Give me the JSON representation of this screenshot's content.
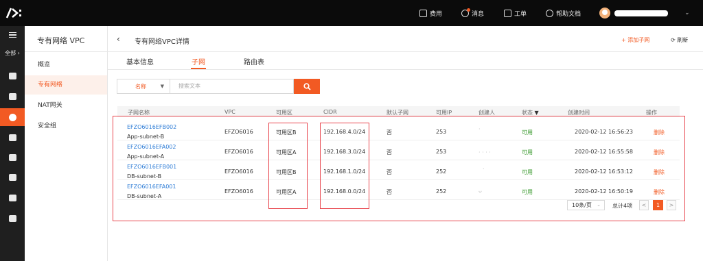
{
  "topbar": {
    "logo_text": "/>:",
    "nav": [
      {
        "icon": "billing-icon",
        "label": "费用"
      },
      {
        "icon": "message-icon",
        "label": "消息"
      },
      {
        "icon": "ticket-icon",
        "label": "工单"
      },
      {
        "icon": "help-icon",
        "label": "帮助文档"
      }
    ]
  },
  "rail": {
    "all_label": "全部",
    "items": [
      "home-icon",
      "database-icon",
      "network-icon",
      "storage-icon",
      "cloud-upload-icon",
      "cloud-icon",
      "cross-box-icon",
      "db-stack-icon"
    ]
  },
  "sidebar": {
    "title": "专有网络 VPC",
    "items": [
      {
        "label": "概览"
      },
      {
        "label": "专有网络"
      },
      {
        "label": "NAT网关"
      },
      {
        "label": "安全组"
      }
    ]
  },
  "header": {
    "back": "‹",
    "title": "专有网络VPC详情",
    "add_subnet": "+ 添加子网",
    "refresh": "刷新"
  },
  "tabs": [
    {
      "label": "基本信息"
    },
    {
      "label": "子网"
    },
    {
      "label": "路由表"
    }
  ],
  "search": {
    "field": "名称",
    "placeholder": "搜索文本"
  },
  "table": {
    "columns": [
      "子网名称",
      "VPC",
      "可用区",
      "CIDR",
      "默认子网",
      "可用IP",
      "创建人",
      "状态",
      "创建时间",
      "操作"
    ],
    "rows": [
      {
        "id": "EFZO6016EFB002",
        "name": "App-subnet-B",
        "vpc": "EFZO6016",
        "zone": "可用区B",
        "cidr": "192.168.4.0/24",
        "default": "否",
        "ips": "253",
        "creator": "·",
        "status": "可用",
        "created": "2020-02-12 16:56:23",
        "action": "删除"
      },
      {
        "id": "EFZO6016EFA002",
        "name": "App-subnet-A",
        "vpc": "EFZO6016",
        "zone": "可用区A",
        "cidr": "192.168.3.0/24",
        "default": "否",
        "ips": "253",
        "creator": "· · · ·",
        "status": "可用",
        "created": "2020-02-12 16:55:58",
        "action": "删除"
      },
      {
        "id": "EFZO6016EFB001",
        "name": "DB-subnet-B",
        "vpc": "EFZO6016",
        "zone": "可用区B",
        "cidr": "192.168.1.0/24",
        "default": "否",
        "ips": "252",
        "creator": "·",
        "status": "可用",
        "created": "2020-02-12 16:53:12",
        "action": "删除"
      },
      {
        "id": "EFZO6016EFA001",
        "name": "DB-subnet-A",
        "vpc": "EFZO6016",
        "zone": "可用区A",
        "cidr": "192.168.0.0/24",
        "default": "否",
        "ips": "252",
        "creator": "ᴗ",
        "status": "可用",
        "created": "2020-02-12 16:50:19",
        "action": "删除"
      }
    ]
  },
  "pagination": {
    "page_size": "10条/页",
    "total": "总计4项",
    "prev": "<",
    "current": "1",
    "next": ">"
  },
  "colors": {
    "accent": "#f25a23",
    "link": "#2d7cd6",
    "ok": "#3a9a2e",
    "annotation": "#e8434b"
  }
}
